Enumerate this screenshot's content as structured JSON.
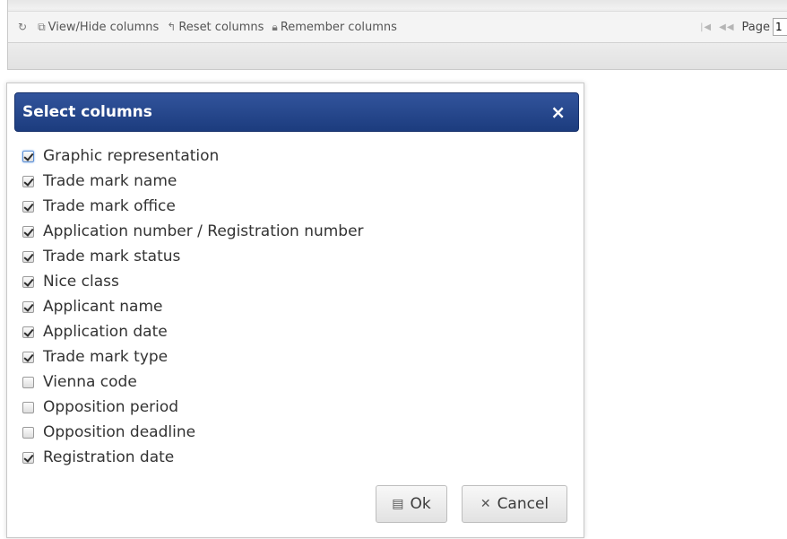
{
  "toolbar": {
    "refresh_icon": "refresh-icon",
    "view_hide": {
      "icon": "columns-icon",
      "label": "View/Hide columns"
    },
    "reset": {
      "icon": "undo-icon",
      "label": "Reset columns"
    },
    "remember": {
      "icon": "lock-icon",
      "label": "Remember columns"
    },
    "pager_first": "|◀",
    "pager_prev": "◀◀",
    "page_label": "Page",
    "page_value": "1"
  },
  "dialog": {
    "title": "Select columns",
    "close_glyph": "×",
    "columns": [
      {
        "label": "Graphic representation",
        "checked": true,
        "focused": true
      },
      {
        "label": "Trade mark name",
        "checked": true
      },
      {
        "label": "Trade mark office",
        "checked": true
      },
      {
        "label": "Application number / Registration number",
        "checked": true
      },
      {
        "label": "Trade mark status",
        "checked": true
      },
      {
        "label": "Nice class",
        "checked": true
      },
      {
        "label": "Applicant name",
        "checked": true
      },
      {
        "label": "Application date",
        "checked": true
      },
      {
        "label": "Trade mark type",
        "checked": true
      },
      {
        "label": "Vienna code",
        "checked": false
      },
      {
        "label": "Opposition period",
        "checked": false
      },
      {
        "label": "Opposition deadline",
        "checked": false
      },
      {
        "label": "Registration date",
        "checked": true
      }
    ],
    "ok_button": {
      "icon": "save-icon",
      "label": "Ok"
    },
    "cancel_button": {
      "icon": "x-icon",
      "label": "Cancel"
    }
  },
  "colors": {
    "header_bg": "#1f3f82",
    "header_text": "#ffffff"
  }
}
